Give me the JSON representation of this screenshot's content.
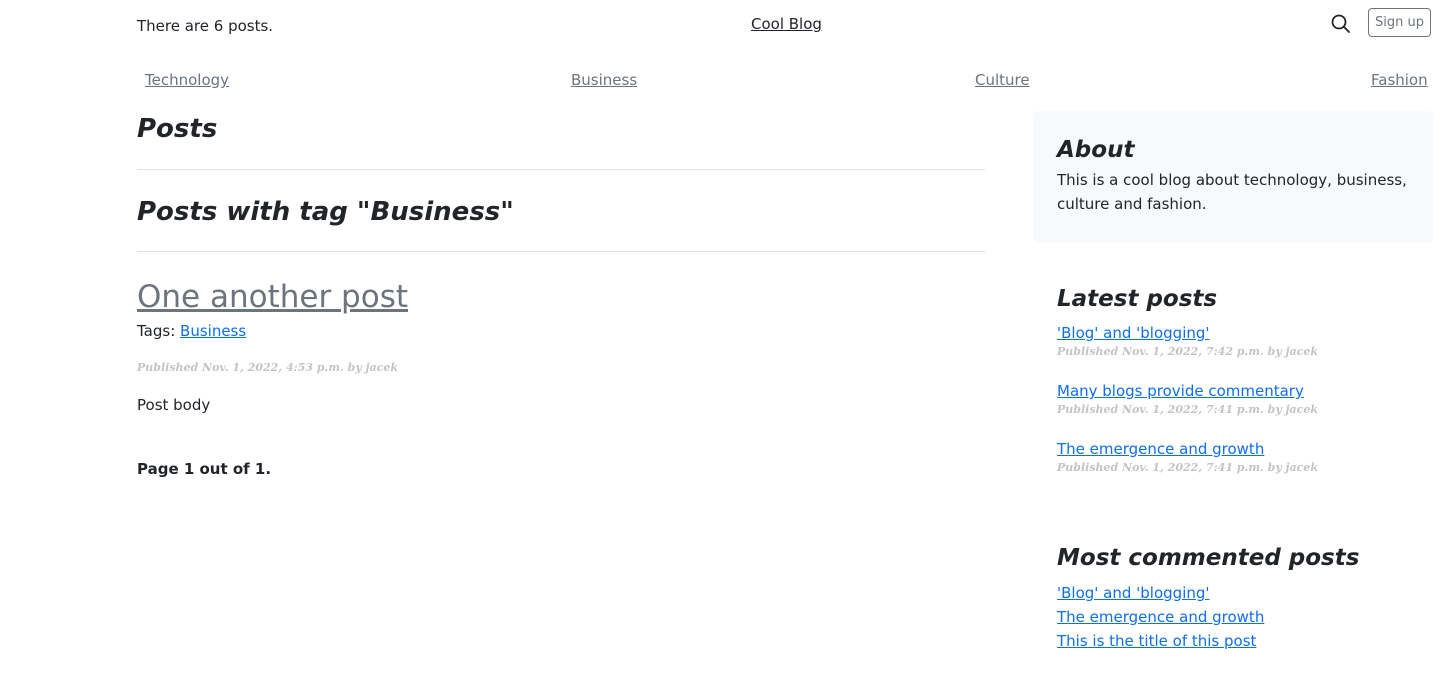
{
  "header": {
    "post_count_text": "There are 6 posts.",
    "logo": "Cool Blog",
    "signup_label": "Sign up"
  },
  "nav": {
    "categories": [
      "Technology",
      "Business",
      "Culture",
      "Fashion"
    ]
  },
  "main": {
    "heading": "Posts",
    "tag_heading": "Posts with tag \"Business\"",
    "post": {
      "title": "One another post",
      "tags_label": "Tags:",
      "tag": "Business",
      "meta": "Published Nov. 1, 2022, 4:53 p.m. by jacek",
      "body": "Post body"
    },
    "pagination": "Page 1 out of 1."
  },
  "sidebar": {
    "about": {
      "title": "About",
      "text": "This is a cool blog about technology, business, culture and fashion."
    },
    "latest": {
      "title": "Latest posts",
      "items": [
        {
          "title": "'Blog' and 'blogging'",
          "meta": "Published Nov. 1, 2022, 7:42 p.m. by jacek"
        },
        {
          "title": "Many blogs provide commentary",
          "meta": "Published Nov. 1, 2022, 7:41 p.m. by jacek"
        },
        {
          "title": "The emergence and growth",
          "meta": "Published Nov. 1, 2022, 7:41 p.m. by jacek"
        }
      ]
    },
    "most_commented": {
      "title": "Most commented posts",
      "items": [
        "'Blog' and 'blogging'",
        "The emergence and growth",
        "This is the title of this post"
      ]
    }
  },
  "icons": {
    "search": "search-icon"
  },
  "colors": {
    "link": "#0d6efd",
    "muted": "#6c757d",
    "about_bg": "#f8f9fa",
    "meta": "#c4c4c4"
  }
}
